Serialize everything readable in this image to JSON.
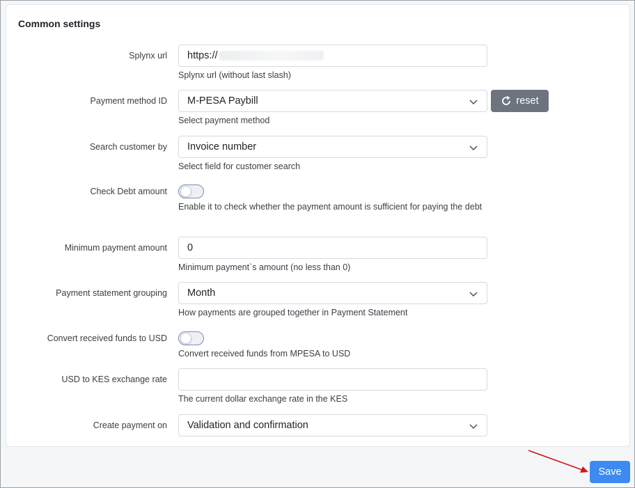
{
  "section_title": "Common settings",
  "fields": {
    "splynx_url": {
      "label": "Splynx url",
      "value": "https://",
      "help": "Splynx url (without last slash)"
    },
    "payment_method": {
      "label": "Payment method ID",
      "value": "M-PESA Paybill",
      "help": "Select payment method",
      "reset_label": "reset"
    },
    "search_customer": {
      "label": "Search customer by",
      "value": "Invoice number",
      "help": "Select field for customer search"
    },
    "check_debt": {
      "label": "Check Debt amount",
      "enabled": false,
      "help": "Enable it to check whether the payment amount is sufficient for paying the debt"
    },
    "min_payment": {
      "label": "Minimum payment amount",
      "value": "0",
      "help": "Minimum payment`s amount (no less than 0)"
    },
    "statement_grouping": {
      "label": "Payment statement grouping",
      "value": "Month",
      "help": "How payments are grouped together in Payment Statement"
    },
    "convert_usd": {
      "label": "Convert received funds to USD",
      "enabled": false,
      "help": "Convert received funds from MPESA to USD"
    },
    "exchange_rate": {
      "label": "USD to KES exchange rate",
      "value": "",
      "help": "The current dollar exchange rate in the KES"
    },
    "create_payment": {
      "label": "Create payment on",
      "value": "Validation and confirmation"
    }
  },
  "save_label": "Save",
  "colors": {
    "save_button": "#3d8bf2",
    "reset_button": "#6c757d",
    "annotation_arrow": "#d0161b"
  },
  "icons": {
    "reset": "refresh-icon",
    "select": "chevron-down-icon",
    "annotation": "red-arrow-icon"
  }
}
